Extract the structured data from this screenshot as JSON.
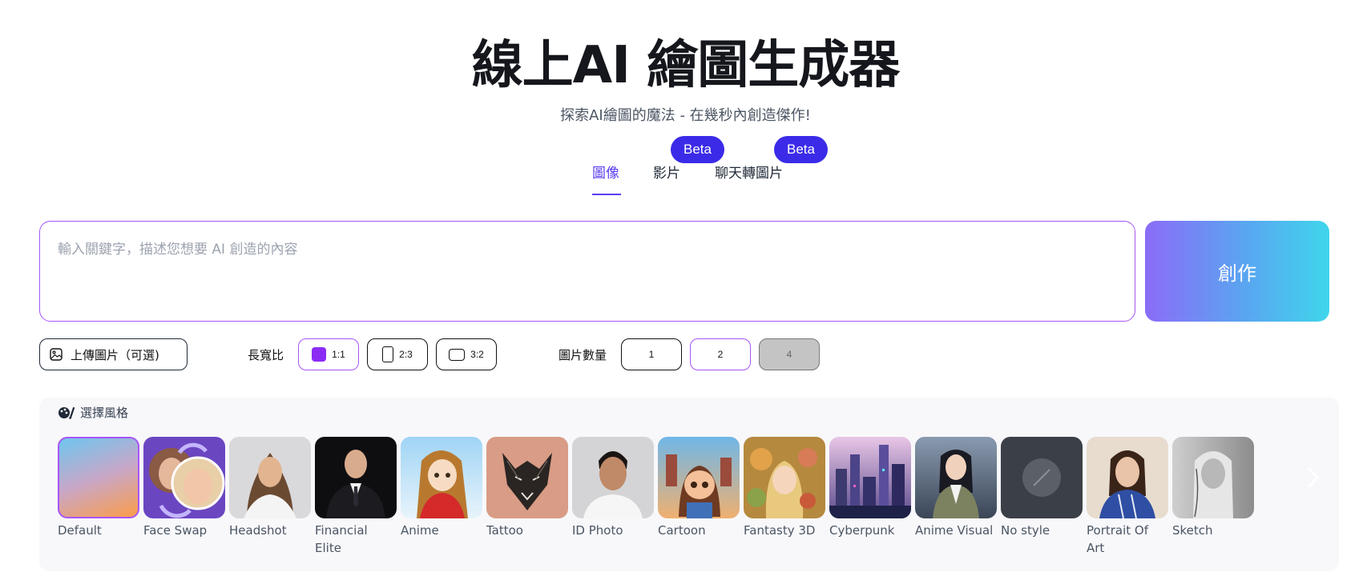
{
  "hero": {
    "title": "線上AI 繪圖生成器",
    "subtitle": "探索AI繪圖的魔法 - 在幾秒內創造傑作!"
  },
  "tabs": [
    {
      "label": "圖像",
      "active": true
    },
    {
      "label": "影片",
      "badge": "Beta"
    },
    {
      "label": "聊天轉圖片",
      "badge": "Beta"
    }
  ],
  "prompt": {
    "placeholder": "輸入關鍵字，描述您想要 AI 創造的內容",
    "value": ""
  },
  "create_button": "創作",
  "options": {
    "upload_label": "上傳圖片（可選)",
    "aspect_label": "長寬比",
    "aspect_ratios": [
      "1:1",
      "2:3",
      "3:2"
    ],
    "aspect_selected": "1:1",
    "count_label": "圖片數量",
    "counts": [
      "1",
      "2",
      "4"
    ],
    "count_selected": "2",
    "count_disabled": "4"
  },
  "styles": {
    "heading": "選擇風格",
    "selected": "Default",
    "items": [
      {
        "label": "Default",
        "icon": "gradient-swatch"
      },
      {
        "label": "Face Swap",
        "icon": "face-swap-thumb"
      },
      {
        "label": "Headshot",
        "icon": "headshot-thumb"
      },
      {
        "label": "Financial Elite",
        "icon": "suit-portrait-thumb"
      },
      {
        "label": "Anime",
        "icon": "anime-thumb"
      },
      {
        "label": "Tattoo",
        "icon": "wolf-tattoo-thumb"
      },
      {
        "label": "ID Photo",
        "icon": "id-photo-thumb"
      },
      {
        "label": "Cartoon",
        "icon": "cartoon-thumb"
      },
      {
        "label": "Fantasty 3D",
        "icon": "fantasy-3d-thumb"
      },
      {
        "label": "Cyberpunk",
        "icon": "cyberpunk-city-thumb"
      },
      {
        "label": "Anime Visual",
        "icon": "anime-visual-thumb"
      },
      {
        "label": "No style",
        "icon": "no-style-icon"
      },
      {
        "label": "Portrait Of Art",
        "icon": "portrait-art-thumb"
      },
      {
        "label": "Sketch",
        "icon": "sketch-thumb"
      }
    ]
  },
  "colors": {
    "accent": "#5b3df5",
    "beta_badge": "#3b2be8",
    "selection_border": "#a855f7",
    "create_gradient_start": "#8b6cf7",
    "create_gradient_end": "#3fd6ec"
  }
}
